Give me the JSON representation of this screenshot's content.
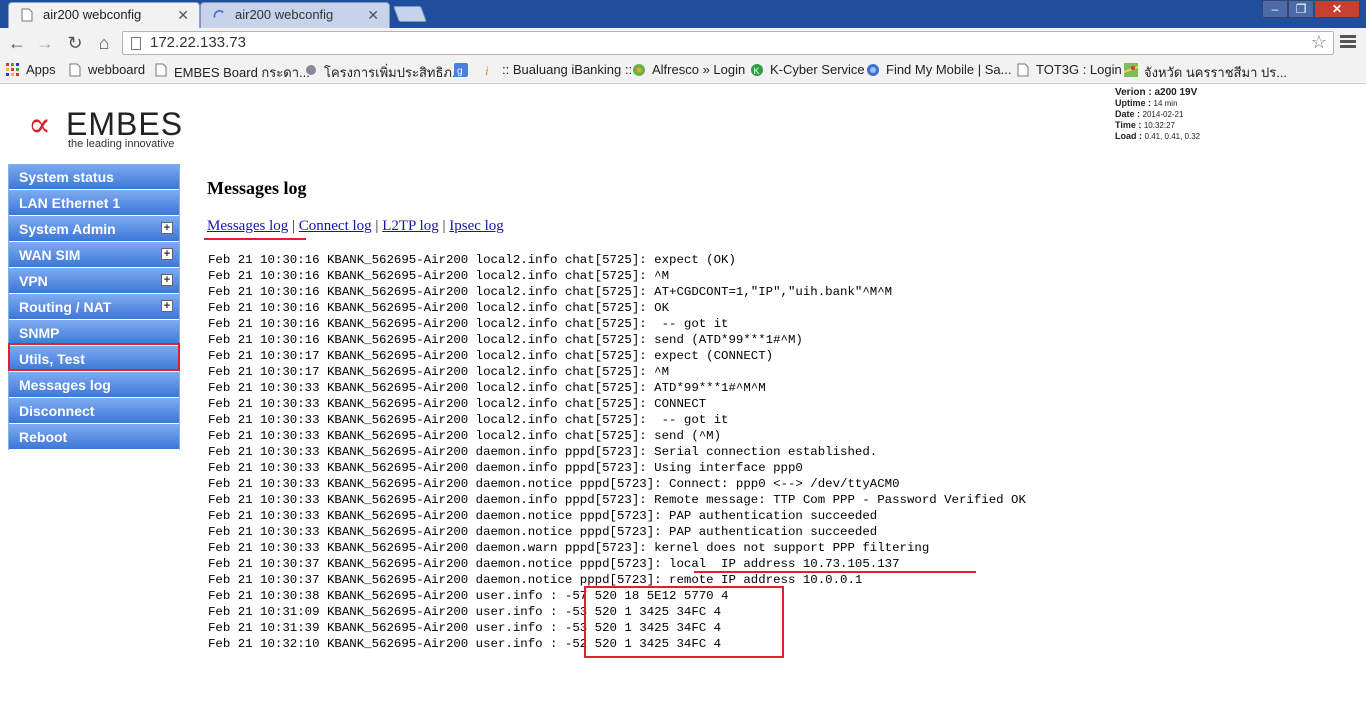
{
  "browser": {
    "tabs": [
      {
        "label": "air200 webconfig",
        "active": true
      },
      {
        "label": "air200 webconfig",
        "active": false
      }
    ],
    "url": "172.22.133.73",
    "bookmarks": [
      "Apps",
      "webboard",
      "EMBES Board กระดา...",
      "โครงการเพิ่มประสิทธิภ...",
      ":: Bualuang iBanking ::",
      "Alfresco » Login",
      "K-Cyber Service",
      "Find My Mobile | Sa...",
      "TOT3G : Login",
      "จังหวัด นครราชสีมา ปร..."
    ]
  },
  "logo": {
    "name": "EMBES",
    "tagline": "the leading innovative"
  },
  "sysinfo": {
    "version_label": "Verion :",
    "version_value": "a200 19V",
    "uptime_label": "Uptime :",
    "uptime_value": "14 min",
    "date_label": "Date :",
    "date_value": "2014-02-21",
    "time_label": "Time :",
    "time_value": "10:32:27",
    "load_label": "Load :",
    "load_value": "0.41, 0.41, 0.32"
  },
  "sidebar": {
    "items": [
      {
        "label": "System status",
        "expandable": false
      },
      {
        "label": "LAN Ethernet 1",
        "expandable": false
      },
      {
        "label": "System Admin",
        "expandable": true
      },
      {
        "label": "WAN SIM",
        "expandable": true
      },
      {
        "label": "VPN",
        "expandable": true
      },
      {
        "label": "Routing / NAT",
        "expandable": true
      },
      {
        "label": "SNMP",
        "expandable": false
      },
      {
        "label": "Utils, Test",
        "expandable": false
      },
      {
        "label": "Messages log",
        "expandable": false
      },
      {
        "label": "Disconnect",
        "expandable": false
      },
      {
        "label": "Reboot",
        "expandable": false
      }
    ],
    "plus_symbol": "+"
  },
  "content": {
    "title": "Messages log",
    "links": [
      "Messages log",
      "Connect log",
      "L2TP log",
      "Ipsec log"
    ],
    "separator": "|"
  },
  "log_lines": [
    "Feb 21 10:30:16 KBANK_562695-Air200 local2.info chat[5725]: expect (OK)",
    "Feb 21 10:30:16 KBANK_562695-Air200 local2.info chat[5725]: ^M",
    "Feb 21 10:30:16 KBANK_562695-Air200 local2.info chat[5725]: AT+CGDCONT=1,\"IP\",\"uih.bank\"^M^M",
    "Feb 21 10:30:16 KBANK_562695-Air200 local2.info chat[5725]: OK",
    "Feb 21 10:30:16 KBANK_562695-Air200 local2.info chat[5725]:  -- got it",
    "Feb 21 10:30:16 KBANK_562695-Air200 local2.info chat[5725]: send (ATD*99***1#^M)",
    "Feb 21 10:30:17 KBANK_562695-Air200 local2.info chat[5725]: expect (CONNECT)",
    "Feb 21 10:30:17 KBANK_562695-Air200 local2.info chat[5725]: ^M",
    "Feb 21 10:30:33 KBANK_562695-Air200 local2.info chat[5725]: ATD*99***1#^M^M",
    "Feb 21 10:30:33 KBANK_562695-Air200 local2.info chat[5725]: CONNECT",
    "Feb 21 10:30:33 KBANK_562695-Air200 local2.info chat[5725]:  -- got it",
    "Feb 21 10:30:33 KBANK_562695-Air200 local2.info chat[5725]: send (^M)",
    "Feb 21 10:30:33 KBANK_562695-Air200 daemon.info pppd[5723]: Serial connection established.",
    "Feb 21 10:30:33 KBANK_562695-Air200 daemon.info pppd[5723]: Using interface ppp0",
    "Feb 21 10:30:33 KBANK_562695-Air200 daemon.notice pppd[5723]: Connect: ppp0 <--> /dev/ttyACM0",
    "Feb 21 10:30:33 KBANK_562695-Air200 daemon.info pppd[5723]: Remote message: TTP Com PPP - Password Verified OK",
    "Feb 21 10:30:33 KBANK_562695-Air200 daemon.notice pppd[5723]: PAP authentication succeeded",
    "Feb 21 10:30:33 KBANK_562695-Air200 daemon.notice pppd[5723]: PAP authentication succeeded",
    "Feb 21 10:30:33 KBANK_562695-Air200 daemon.warn pppd[5723]: kernel does not support PPP filtering",
    "Feb 21 10:30:37 KBANK_562695-Air200 daemon.notice pppd[5723]: local  IP address 10.73.105.137",
    "Feb 21 10:30:37 KBANK_562695-Air200 daemon.notice pppd[5723]: remote IP address 10.0.0.1",
    "Feb 21 10:30:38 KBANK_562695-Air200 user.info : -57 520 18 5E12 5770 4",
    "Feb 21 10:31:09 KBANK_562695-Air200 user.info : -53 520 1 3425 34FC 4",
    "Feb 21 10:31:39 KBANK_562695-Air200 user.info : -53 520 1 3425 34FC 4",
    "Feb 21 10:32:10 KBANK_562695-Air200 user.info : -52 520 1 3425 34FC 4"
  ],
  "colors": {
    "annotation_red": "#e0202e",
    "sidebar_blue": "#3b77d8",
    "link_blue": "#1515aa",
    "titlebar": "#1f4e9c"
  }
}
